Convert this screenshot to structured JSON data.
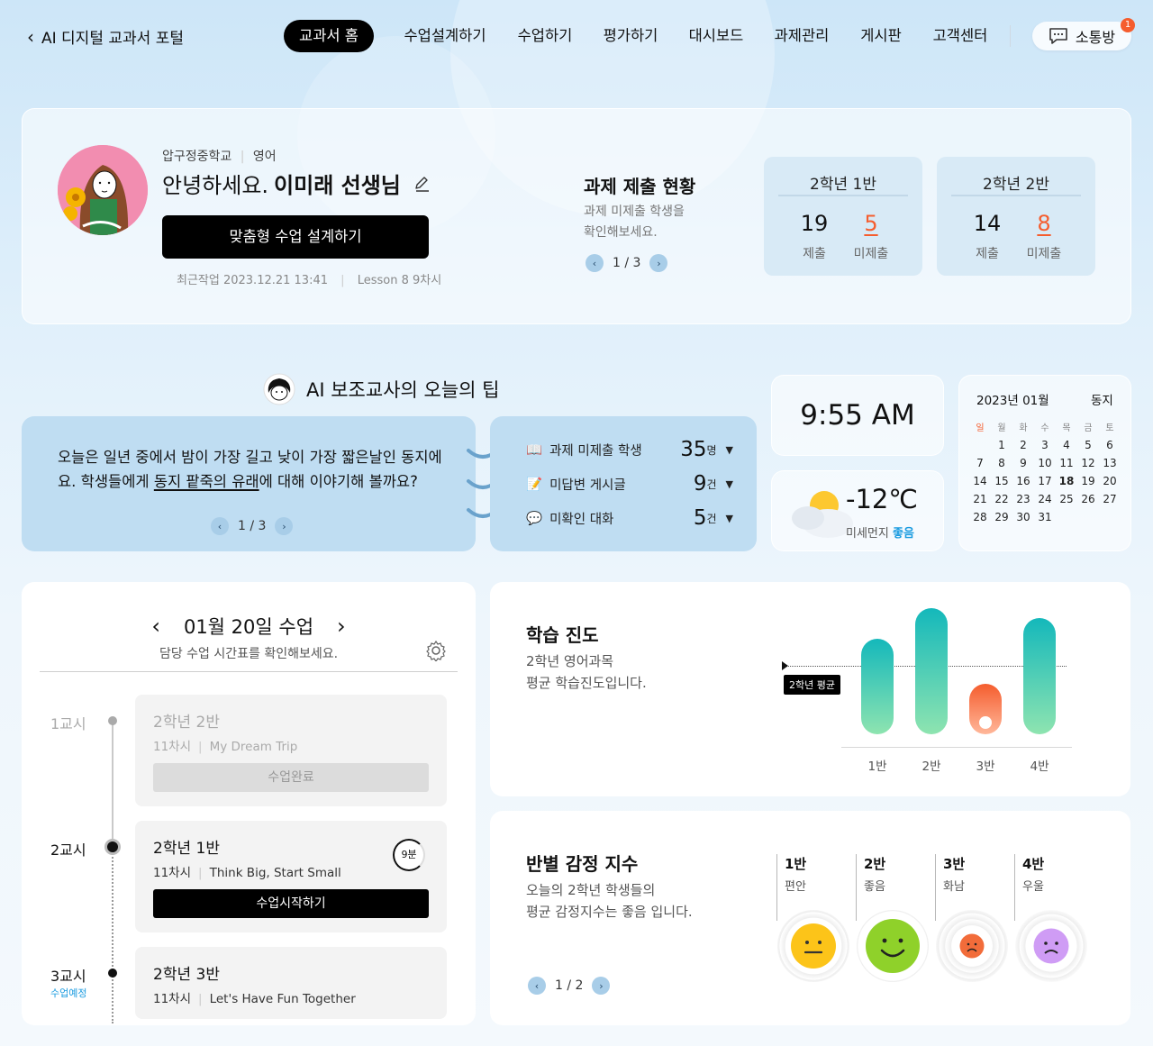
{
  "nav": {
    "back_label": "AI 디지털 교과서 포털",
    "items": [
      {
        "label": "교과서 홈",
        "active": true
      },
      {
        "label": "수업설계하기"
      },
      {
        "label": "수업하기"
      },
      {
        "label": "평가하기"
      },
      {
        "label": "대시보드"
      },
      {
        "label": "과제관리"
      },
      {
        "label": "게시판"
      },
      {
        "label": "고객센터"
      }
    ],
    "chat_label": "소통방",
    "chat_badge": "1"
  },
  "profile": {
    "school": "압구정중학교",
    "subject": "영어",
    "greeting": "안녕하세요.",
    "teacher_name": "이미래 선생님",
    "design_button": "맞춤형 수업 설계하기",
    "recent_label": "최근작업 2023.12.21 13:41",
    "recent_lesson": "Lesson 8 9차시"
  },
  "assignment": {
    "title": "과제 제출 현황",
    "desc_line1": "과제 미제출 학생을",
    "desc_line2": "확인해보세요.",
    "pager": "1 / 3",
    "classes": [
      {
        "name": "2학년 1반",
        "submitted": "19",
        "missing": "5",
        "submitted_label": "제출",
        "missing_label": "미제출"
      },
      {
        "name": "2학년 2반",
        "submitted": "14",
        "missing": "8",
        "submitted_label": "제출",
        "missing_label": "미제출"
      }
    ]
  },
  "tip": {
    "title": "AI 보조교사의 오늘의 팁",
    "text_before": "오늘은 일년 중에서 밤이 가장 길고 낮이 가장 짧은날인 동지에요. 학생들에게 ",
    "text_link": "동지 팥죽의 유래",
    "text_after": "에 대해 이야기해 볼까요?",
    "pager": "1 / 3"
  },
  "stats": [
    {
      "label": "과제 미제출 학생",
      "value": "35",
      "unit": "명"
    },
    {
      "label": "미답변 게시글",
      "value": "9",
      "unit": "건"
    },
    {
      "label": "미확인 대화",
      "value": "5",
      "unit": "건"
    }
  ],
  "clock": "9:55 AM",
  "weather": {
    "temp": "-12℃",
    "dust_label": "미세먼지",
    "dust_value": "좋음"
  },
  "calendar": {
    "month": "2023년 01월",
    "event": "동지",
    "weekdays": [
      "일",
      "월",
      "화",
      "수",
      "목",
      "금",
      "토"
    ],
    "today": "18",
    "weeks": [
      [
        "",
        "1",
        "2",
        "3",
        "4",
        "5",
        "6"
      ],
      [
        "7",
        "8",
        "9",
        "10",
        "11",
        "12",
        "13"
      ],
      [
        "14",
        "15",
        "16",
        "17",
        "18",
        "19",
        "20"
      ],
      [
        "21",
        "22",
        "23",
        "24",
        "25",
        "26",
        "27"
      ],
      [
        "28",
        "29",
        "30",
        "31",
        "",
        "",
        ""
      ]
    ]
  },
  "timetable": {
    "title": "01월 20일 수업",
    "subtitle": "담당 수업 시간표를 확인해보세요.",
    "periods": [
      {
        "period": "1교시",
        "class": "2학년 2반",
        "session": "11차시",
        "topic": "My Dream Trip",
        "button": "수업완료",
        "status": "done"
      },
      {
        "period": "2교시",
        "class": "2학년 1반",
        "session": "11차시",
        "topic": "Think Big, Start Small",
        "button": "수업시작하기",
        "timer": "9분",
        "status": "current"
      },
      {
        "period": "3교시",
        "class": "2학년 3반",
        "session": "11차시",
        "topic": "Let's Have Fun Together",
        "status_label": "수업예정",
        "status": "upcoming"
      }
    ]
  },
  "progress": {
    "title": "학습 진도",
    "desc_line1": "2학년 영어과목",
    "desc_line2": "평균 학습진도입니다.",
    "avg_label": "2학년 평균",
    "chart_data": {
      "type": "bar",
      "categories": [
        "1반",
        "2반",
        "3반",
        "4반"
      ],
      "values": [
        76,
        100,
        40,
        92
      ],
      "average": 54,
      "ylim": [
        0,
        100
      ]
    },
    "colors": {
      "teal": "#14b8bb",
      "mint": "#8ee4b0",
      "orange": "#f55d2e",
      "peach": "#ffb79a"
    }
  },
  "emotion": {
    "title": "반별 감정 지수",
    "desc_line1": "오늘의 2학년 학생들의",
    "desc_line2": "평균 감정지수는 좋음 입니다.",
    "pager": "1 / 2",
    "classes": [
      {
        "name": "1반",
        "emotion": "편안",
        "icon": "neutral-face-icon",
        "color": "#fcc419"
      },
      {
        "name": "2반",
        "emotion": "좋음",
        "icon": "smile-face-icon",
        "color": "#8fd12a"
      },
      {
        "name": "3반",
        "emotion": "화남",
        "icon": "angry-face-icon",
        "color": "#f26c3a"
      },
      {
        "name": "4반",
        "emotion": "우울",
        "icon": "sad-face-icon",
        "color": "#cf9cf5"
      }
    ]
  }
}
